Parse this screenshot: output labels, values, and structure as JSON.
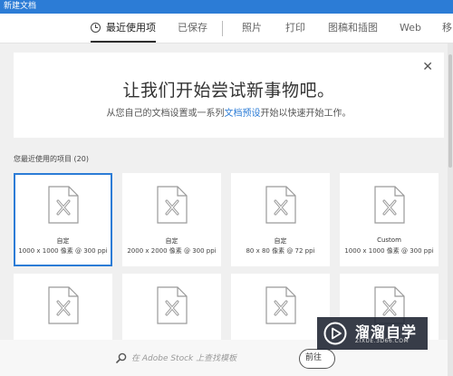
{
  "window": {
    "title": "新建文档"
  },
  "tabs": [
    {
      "label": "最近使用项",
      "active": true
    },
    {
      "label": "已保存"
    },
    {
      "label": "照片"
    },
    {
      "label": "打印"
    },
    {
      "label": "图稿和插图"
    },
    {
      "label": "Web"
    },
    {
      "label": "移"
    }
  ],
  "welcome": {
    "title": "让我们开始尝试新事物吧。",
    "subtitle_before": "从您自己的文档设置或一系列",
    "subtitle_link": "文档预设",
    "subtitle_after": "开始以快速开始工作。",
    "close_glyph": "✕"
  },
  "recent": {
    "label": "您最近使用的项目",
    "count": "(20)",
    "items": [
      {
        "name": "自定",
        "detail": "1000 x 1000 像素 @ 300 ppi",
        "selected": true
      },
      {
        "name": "自定",
        "detail": "2000 x 2000 像素 @ 300 ppi"
      },
      {
        "name": "自定",
        "detail": "80 x 80 像素 @ 72 ppi"
      },
      {
        "name": "Custom",
        "detail": "1000 x 1000 像素 @ 300 ppi"
      },
      {
        "name": "",
        "detail": ""
      },
      {
        "name": "",
        "detail": ""
      },
      {
        "name": "",
        "detail": ""
      },
      {
        "name": "",
        "detail": ""
      }
    ]
  },
  "search": {
    "prefix": "在 Adobe Stock 上查找模板",
    "button_label": "前往"
  },
  "watermark": {
    "title": "溜溜自学",
    "url": "ZIXUE.3D66.COM"
  },
  "colors": {
    "accent": "#2c7cd6",
    "titlebar": "#2c7cd6"
  },
  "icons": {
    "recent_tab": "clock-icon",
    "close": "close-icon",
    "search": "search-icon",
    "card": "document-icon"
  }
}
